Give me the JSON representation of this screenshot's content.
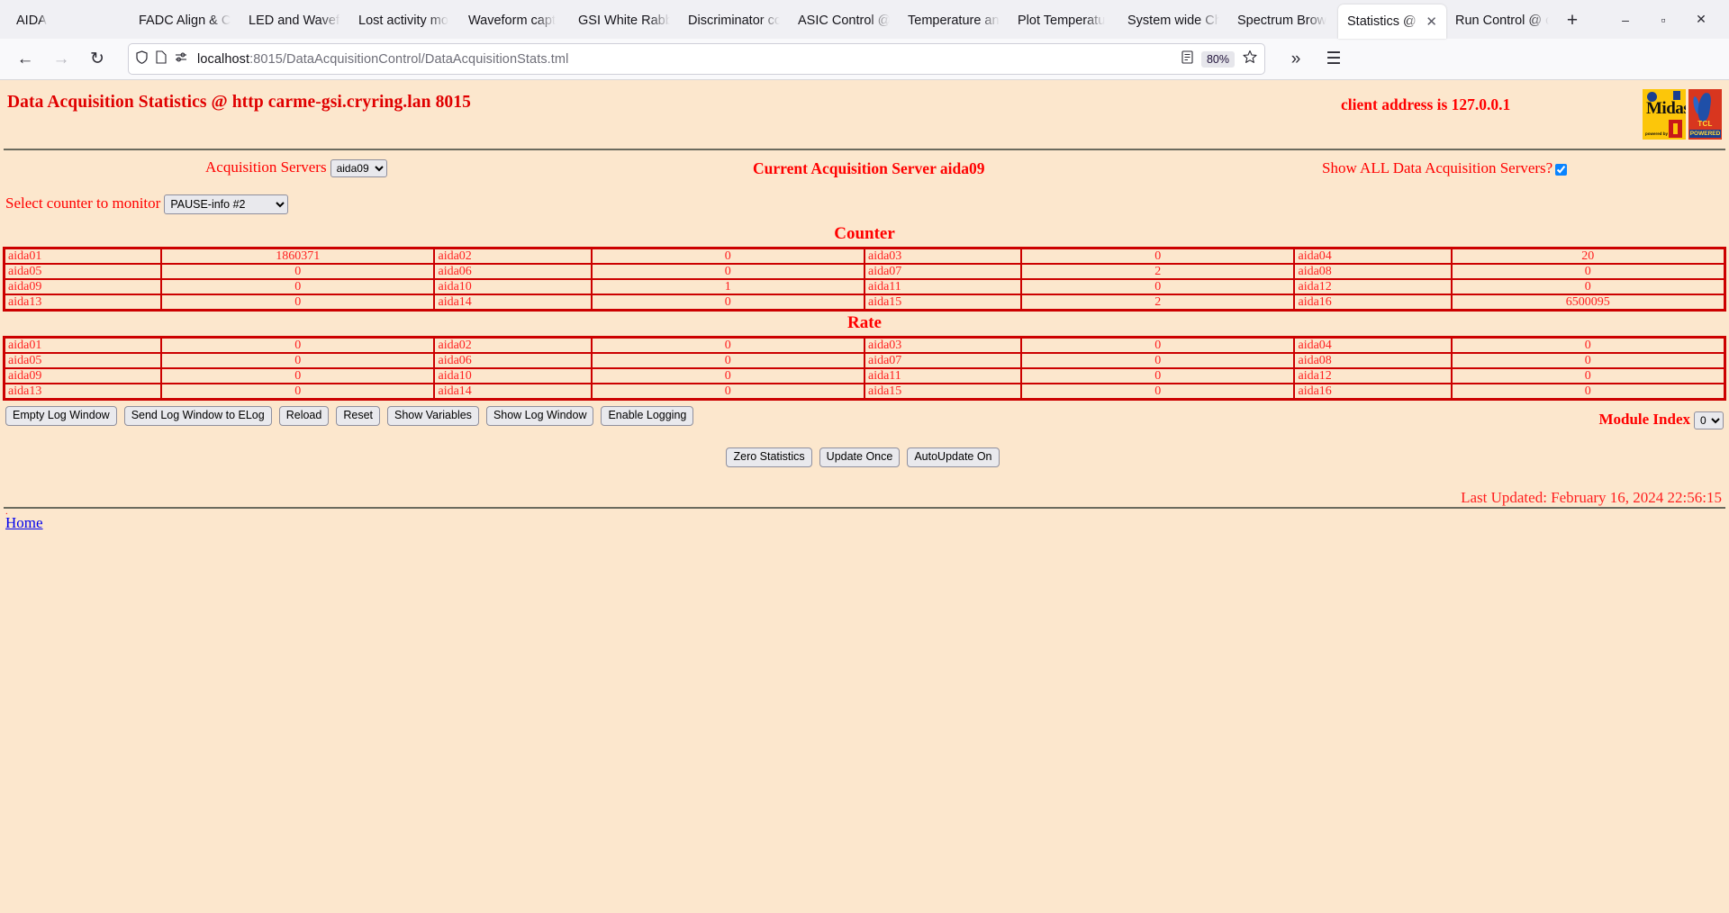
{
  "browser": {
    "tabs": [
      {
        "label": "AIDA",
        "active": false
      },
      {
        "label": "FADC Align & C",
        "active": false
      },
      {
        "label": "LED and Wavefo",
        "active": false
      },
      {
        "label": "Lost activity mo",
        "active": false
      },
      {
        "label": "Waveform capt",
        "active": false
      },
      {
        "label": "GSI White Rabb",
        "active": false
      },
      {
        "label": "Discriminator co",
        "active": false
      },
      {
        "label": "ASIC Control @",
        "active": false
      },
      {
        "label": "Temperature an",
        "active": false
      },
      {
        "label": "Plot Temperatu",
        "active": false
      },
      {
        "label": "System wide Ch",
        "active": false
      },
      {
        "label": "Spectrum Brow",
        "active": false
      },
      {
        "label": "Statistics @ c",
        "active": true
      },
      {
        "label": "Run Control @ c",
        "active": false
      }
    ],
    "new_tab_label": "+",
    "window_controls": {
      "minimize": "–",
      "maximize": "▫",
      "close": "✕"
    },
    "nav": {
      "back": "←",
      "forward": "→",
      "reload": "↻"
    },
    "url": {
      "host": "localhost",
      "path": ":8015/DataAcquisitionControl/DataAcquisitionStats.tml",
      "shield_icon": "shield-icon",
      "page_icon": "page-icon",
      "permissions_icon": "permissions-icon"
    },
    "toolbar": {
      "reader_icon": "reader-view-icon",
      "zoom_level": "80%",
      "bookmark_icon": "star-icon",
      "overflow": "»",
      "menu": "☰"
    },
    "tab_close_glyph": "✕"
  },
  "page": {
    "title": "Data Acquisition Statistics @ http carme-gsi.cryring.lan 8015",
    "client_address": "client address is 127.0.0.1",
    "logos": {
      "midas": {
        "word": "Midas",
        "sub": "powered by",
        "name": "midas-logo"
      },
      "tcl": {
        "word": "TCL",
        "powered": "POWERED",
        "name": "tcl-powered-logo"
      }
    },
    "controls": {
      "acquisition_servers_label": "Acquisition Servers",
      "acquisition_servers_value": "aida09",
      "acquisition_servers_options": [
        "aida09"
      ],
      "current_server": "Current Acquisition Server aida09",
      "show_all_label": "Show ALL Data Acquisition Servers?",
      "show_all_checked": true,
      "select_counter_label": "Select counter to monitor",
      "select_counter_value": "PAUSE-info #2",
      "select_counter_options": [
        "PAUSE-info #2"
      ]
    },
    "counter": {
      "heading": "Counter",
      "rows": [
        [
          {
            "name": "aida01",
            "value": "1860371"
          },
          {
            "name": "aida02",
            "value": "0"
          },
          {
            "name": "aida03",
            "value": "0"
          },
          {
            "name": "aida04",
            "value": "20"
          }
        ],
        [
          {
            "name": "aida05",
            "value": "0"
          },
          {
            "name": "aida06",
            "value": "0"
          },
          {
            "name": "aida07",
            "value": "2"
          },
          {
            "name": "aida08",
            "value": "0"
          }
        ],
        [
          {
            "name": "aida09",
            "value": "0"
          },
          {
            "name": "aida10",
            "value": "1"
          },
          {
            "name": "aida11",
            "value": "0"
          },
          {
            "name": "aida12",
            "value": "0"
          }
        ],
        [
          {
            "name": "aida13",
            "value": "0"
          },
          {
            "name": "aida14",
            "value": "0"
          },
          {
            "name": "aida15",
            "value": "2"
          },
          {
            "name": "aida16",
            "value": "6500095"
          }
        ]
      ]
    },
    "rate": {
      "heading": "Rate",
      "rows": [
        [
          {
            "name": "aida01",
            "value": "0"
          },
          {
            "name": "aida02",
            "value": "0"
          },
          {
            "name": "aida03",
            "value": "0"
          },
          {
            "name": "aida04",
            "value": "0"
          }
        ],
        [
          {
            "name": "aida05",
            "value": "0"
          },
          {
            "name": "aida06",
            "value": "0"
          },
          {
            "name": "aida07",
            "value": "0"
          },
          {
            "name": "aida08",
            "value": "0"
          }
        ],
        [
          {
            "name": "aida09",
            "value": "0"
          },
          {
            "name": "aida10",
            "value": "0"
          },
          {
            "name": "aida11",
            "value": "0"
          },
          {
            "name": "aida12",
            "value": "0"
          }
        ],
        [
          {
            "name": "aida13",
            "value": "0"
          },
          {
            "name": "aida14",
            "value": "0"
          },
          {
            "name": "aida15",
            "value": "0"
          },
          {
            "name": "aida16",
            "value": "0"
          }
        ]
      ]
    },
    "buttons_row1": [
      "Empty Log Window",
      "Send Log Window to ELog",
      "Reload",
      "Reset",
      "Show Variables",
      "Show Log Window",
      "Enable Logging"
    ],
    "module_index_label": "Module Index",
    "module_index_value": "0",
    "module_index_options": [
      "0"
    ],
    "buttons_row2": [
      "Zero Statistics",
      "Update Once",
      "AutoUpdate On"
    ],
    "last_updated": "Last Updated: February 16, 2024 22:56:15",
    "dot": ".",
    "home_link": "Home"
  },
  "colors": {
    "page_bg": "#fce7cd",
    "red_text": "#ff0000",
    "table_border": "#cc0000",
    "link_blue": "#0000ee",
    "rule": "#6b6b5e"
  }
}
